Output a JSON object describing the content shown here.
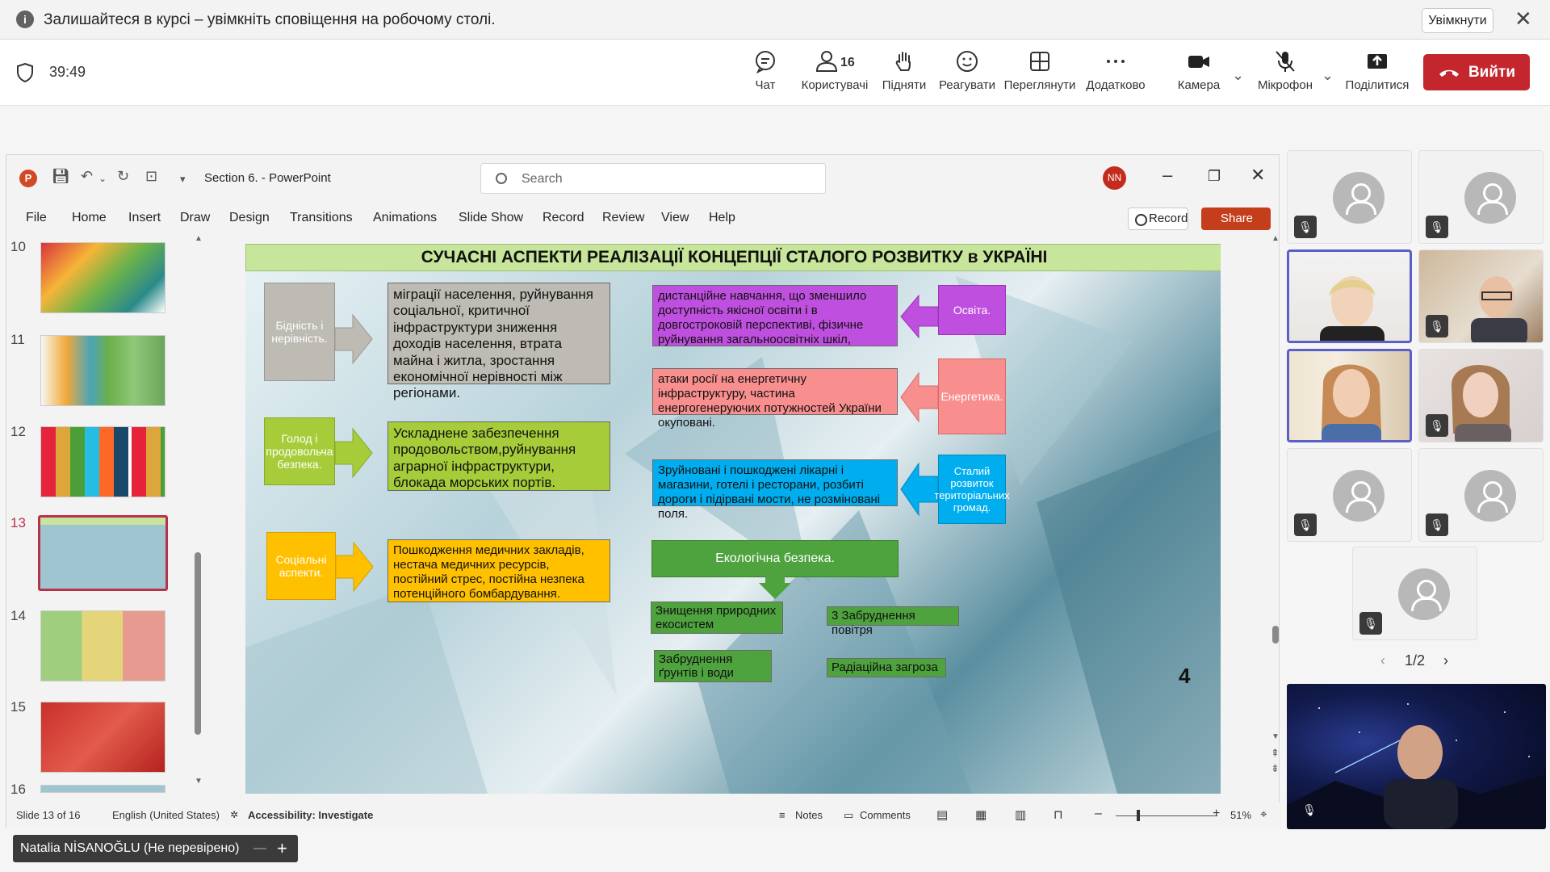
{
  "notification": {
    "message": "Залишайтеся в курсі – увімкніть сповіщення на робочому столі.",
    "enable_label": "Увімкнути"
  },
  "meeting": {
    "timer": "39:49",
    "toolbar": [
      {
        "label": "Чат",
        "icon": "chat-icon"
      },
      {
        "label": "Користувачі",
        "icon": "people-icon",
        "count": "16"
      },
      {
        "label": "Підняти",
        "icon": "raise-hand-icon"
      },
      {
        "label": "Реагувати",
        "icon": "emoji-icon"
      },
      {
        "label": "Переглянути",
        "icon": "view-grid-icon"
      },
      {
        "label": "Додатково",
        "icon": "more-icon"
      },
      {
        "label": "Камера",
        "icon": "camera-icon"
      },
      {
        "label": "Мікрофон",
        "icon": "mic-off-icon"
      },
      {
        "label": "Поділитися",
        "icon": "share-icon"
      }
    ],
    "leave_label": "Вийти",
    "leave_color": "#c4262e",
    "pager": "1/2",
    "participant_name": "Natalia NİSANOĞLU (Не перевірено)"
  },
  "powerpoint": {
    "file_name": "Section 6.",
    "app_name": "PowerPoint",
    "search_placeholder": "Search",
    "user_initials": "NN",
    "menu": [
      "File",
      "Home",
      "Insert",
      "Draw",
      "Design",
      "Transitions",
      "Animations",
      "Slide Show",
      "Record",
      "Review",
      "View",
      "Help"
    ],
    "record_label": "Record",
    "share_label": "Share",
    "thumb_numbers": [
      "10",
      "11",
      "12",
      "13",
      "14",
      "15",
      "16"
    ],
    "selected_slide": "13",
    "status": {
      "slide": "Slide 13 of 16",
      "language": "English (United States)",
      "accessibility": "Accessibility: Investigate",
      "notes": "Notes",
      "comments": "Comments",
      "zoom": "51%"
    }
  },
  "slide": {
    "title": "СУЧАСНІ АСПЕКТИ РЕАЛІЗАЦІЇ КОНЦЕПЦІЇ СТАЛОГО РОЗВИТКУ в УКРАЇНІ",
    "left": [
      {
        "label": "Бідність і нерівність.",
        "text": "міграції населення, руйнування соціальної, критичної інфраструктури зниження доходів населення, втрата майна і житла, зростання економічної нерівності між регіонами.",
        "color": "#bebab4",
        "textcolor": "#bebab4"
      },
      {
        "label": "Голод і продовольча безпека.",
        "text": "Ускладнене забезпечення продовольством,руйнування аграрної інфраструктури, блокада морських портів.",
        "color": "#a6cc3a",
        "textcolor": "#a6cc3a"
      },
      {
        "label": "Соціальні аспекти.",
        "text": "Пошкодження медичних закладів, нестача медичних ресурсів, постійний стрес, постійна незпека потенційного бомбардування.",
        "color": "#ffc000",
        "textcolor": "#ffc000"
      }
    ],
    "right": [
      {
        "label": "Освіта.",
        "text": "дистанційне навчання, що зменшило доступність якісної освіти і в довгостроковій перспективі, фізичне руйнування загальноосвітніх шкіл,",
        "color": "#bf4fdf",
        "textcolor": "#bf4fdf"
      },
      {
        "label": "Енергетика.",
        "text": "атаки росії на енергетичну інфраструктуру, частина енергогенеруючих потужностей України окуповані.",
        "color": "#f88e8e",
        "textcolor": "#f88e8e"
      },
      {
        "label": "Сталий розвиток територіальних громад.",
        "text": "Зруйновані і пошкоджені лікарні і магазини, готелі і ресторани, розбиті дороги і підірвані мости, не розміновані поля.",
        "color": "#00aeef",
        "textcolor": "#00aeef"
      }
    ],
    "eco": {
      "header": "Екологічна безпека.",
      "items": [
        "Знищення природних екосистем",
        "3 Забруднення повітря",
        "Забруднення ґрунтів і води",
        "Радіаційна загроза"
      ],
      "color": "#4ea33e",
      "header_color": "#2e8b3a"
    },
    "page_number": "4"
  }
}
